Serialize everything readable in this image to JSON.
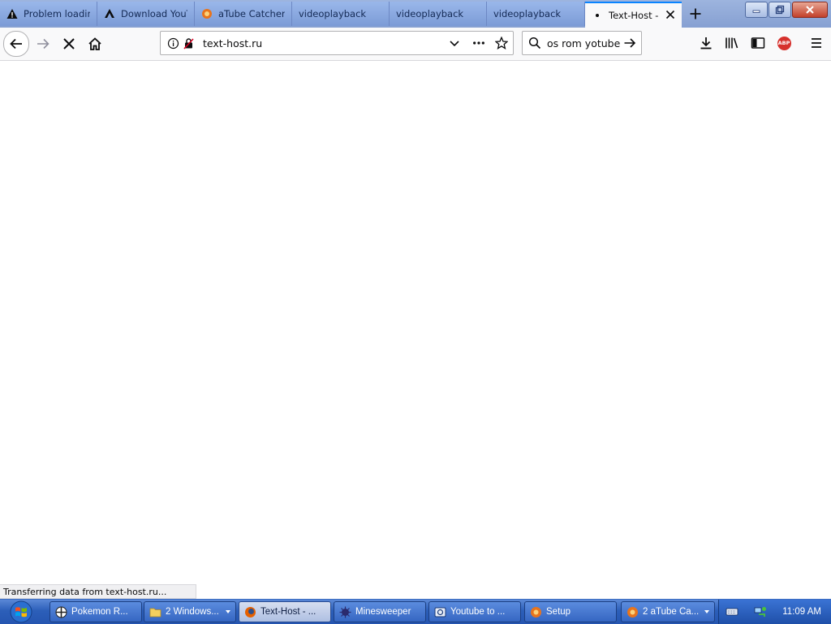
{
  "browser": {
    "tabs": [
      {
        "label": "Problem loading page",
        "icon": "warning-icon"
      },
      {
        "label": "Download YouTube",
        "icon": "download-site-icon"
      },
      {
        "label": "aTube Catcher",
        "icon": "atube-icon"
      },
      {
        "label": "videoplayback",
        "icon": ""
      },
      {
        "label": "videoplayback",
        "icon": ""
      },
      {
        "label": "videoplayback",
        "icon": ""
      },
      {
        "label": "Text-Host - ",
        "icon": "loading-dot-icon",
        "active": true
      }
    ],
    "address": "text-host.ru",
    "search_query": "os rom yotube",
    "status": "Transferring data from text-host.ru...",
    "adblock_label": "ABP"
  },
  "taskbar": {
    "items": [
      {
        "label": "Pokemon R...",
        "icon": "pokemon-app-icon"
      },
      {
        "label": "2 Windows...",
        "icon": "folder-icon",
        "group": true
      },
      {
        "label": "Text-Host - ...",
        "icon": "firefox-icon",
        "active": true
      },
      {
        "label": "Minesweeper",
        "icon": "minesweeper-icon"
      },
      {
        "label": "Youtube to ...",
        "icon": "youtube-converter-icon"
      },
      {
        "label": "Setup",
        "icon": "atube-icon"
      },
      {
        "label": "2 aTube Ca...",
        "icon": "atube-icon",
        "group": true
      }
    ],
    "clock": "11:09 AM"
  },
  "colors": {
    "tab_accent": "#0a84ff",
    "taskbar": "#2c5fb9",
    "abp_red": "#d6312d"
  }
}
